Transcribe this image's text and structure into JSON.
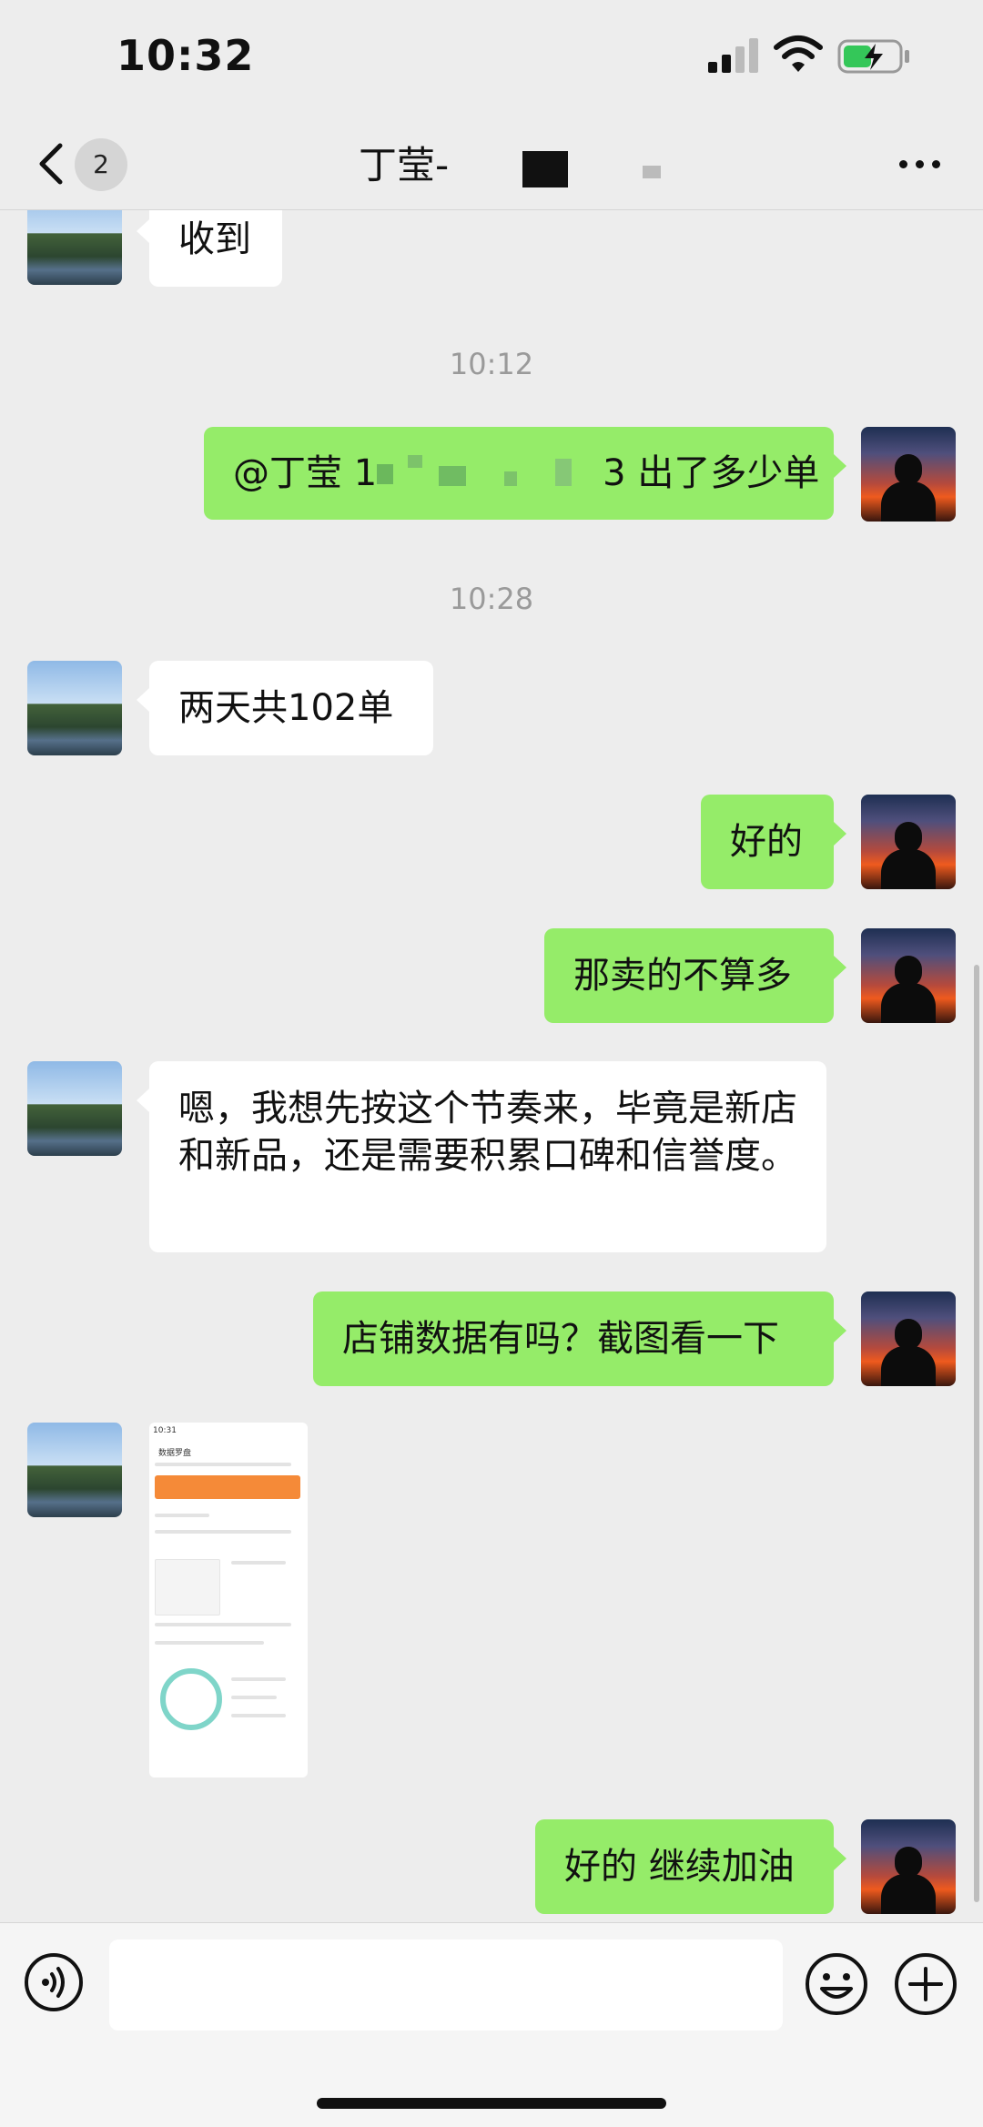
{
  "status": {
    "time": "10:32"
  },
  "nav": {
    "back_badge": "2",
    "title": "丁莹-"
  },
  "messages": [
    {
      "side": "in",
      "text": "收到"
    },
    {
      "type": "time",
      "text": "10:12"
    },
    {
      "side": "out",
      "text_prefix": "@丁莹 1",
      "text_suffix": "3 出了多少单"
    },
    {
      "type": "time",
      "text": "10:28"
    },
    {
      "side": "in",
      "text": "两天共102单"
    },
    {
      "side": "out",
      "text": "好的"
    },
    {
      "side": "out",
      "text": "那卖的不算多"
    },
    {
      "side": "in",
      "text": "嗯，我想先按这个节奏来，毕竟是新店和新品，还是需要积累口碑和信誉度。"
    },
    {
      "side": "out",
      "text": "店铺数据有吗？截图看一下"
    },
    {
      "side": "in",
      "type": "image",
      "caption": "数据罗盘"
    },
    {
      "side": "out",
      "text": "好的 继续加油"
    }
  ],
  "icons": {
    "voice": "voice-icon",
    "emoji": "emoji-icon",
    "plus": "plus-icon",
    "back": "chevron-left-icon",
    "more": "more-icon"
  },
  "colors": {
    "background": "#ededed",
    "bubble_out": "#95ec69",
    "bubble_in": "#ffffff"
  }
}
